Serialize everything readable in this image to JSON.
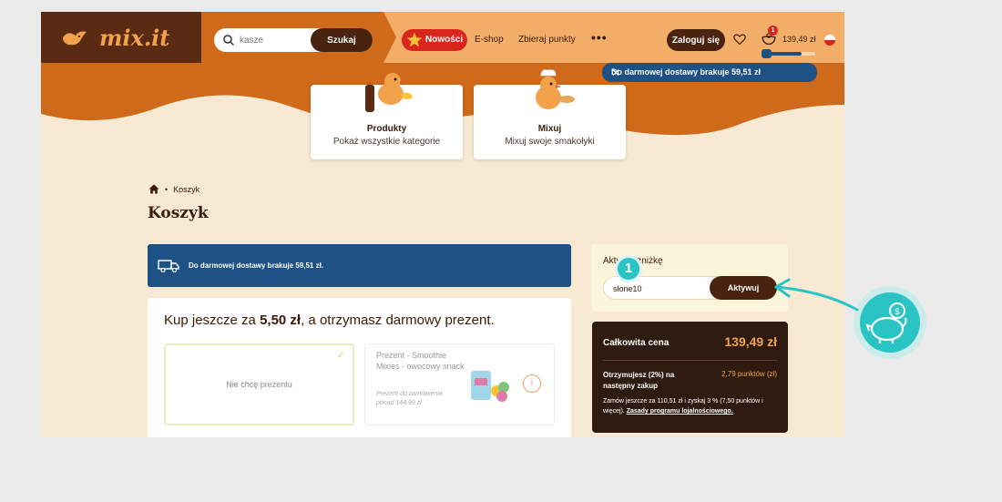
{
  "header": {
    "logo_text": "mix.it",
    "search": {
      "placeholder": "kasze",
      "button_label": "Szukaj"
    },
    "nav": {
      "new_label": "Nowości",
      "eshop_label": "E-shop",
      "points_label": "Zbieraj punkty",
      "more_label": "•••"
    },
    "login_label": "Zaloguj się",
    "cart_badge": "1",
    "cart_total": "139,49 zł",
    "free_delivery_progress": 0.7,
    "free_delivery_pill": "Do darmowej dostawy brakuje 59,51 zł",
    "close_symbol": "✕"
  },
  "categories": [
    {
      "title": "Produkty",
      "subtitle": "Pokaż wszystkie kategorie"
    },
    {
      "title": "Mixuj",
      "subtitle": "Mixuj swoje smakołyki"
    }
  ],
  "breadcrumb": {
    "separator": "•",
    "current": "Koszyk"
  },
  "page_title": "Koszyk",
  "delivery_banner": "Do darmowej dostawy brakuje 59,51 zł.",
  "gift": {
    "headline_prefix": "Kup jeszcze za ",
    "headline_amount": "5,50 zł",
    "headline_suffix": ", a otrzymasz darmowy prezent.",
    "no_gift_label": "Nie chcę prezentu",
    "check_symbol": "✓",
    "option_name": "Prezent - Smoothie Mixies - owocowy snack",
    "option_condition": "Prezent do zamówienia ponad 144,99 zł",
    "info_symbol": "i"
  },
  "discount": {
    "label": "Aktywuj zniżkę",
    "code_value": "słone10",
    "button_label": "Aktywuj",
    "step_number": "1"
  },
  "total": {
    "label": "Całkowita cena",
    "value": "139,49 zł",
    "earn_label": "Otrzymujesz (2%) na następny zakup",
    "earn_value": "2,79 punktów (zł)",
    "note": "Zamów jeszcze za 110,51 zł i zyskaj 3 % (7,50 punktów i więcej).",
    "note_link": "Zasady programu lojalnościowego."
  },
  "colors": {
    "brand_dark": "#4a2210",
    "brand_orange": "#cf6a1b",
    "header_light": "#f2ae68",
    "delivery_blue": "#1e5285",
    "accent_red": "#d9261c",
    "callout_teal": "#2bc4c4",
    "cream": "#f7e9d2"
  }
}
